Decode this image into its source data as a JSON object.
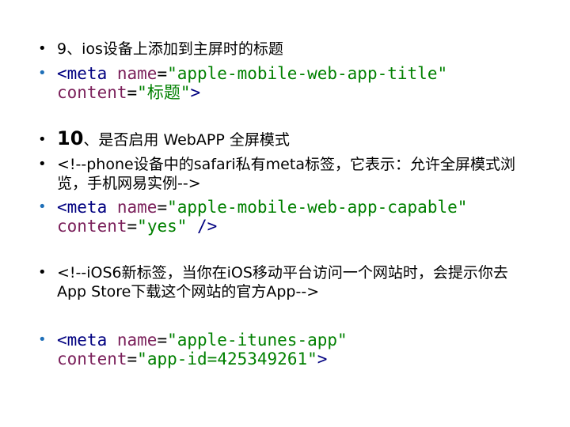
{
  "items": [
    {
      "text": "9、ios设备上添加到主屏时的标题"
    },
    {
      "tag_open": "<meta ",
      "name_attr": "name",
      "eq1": "=",
      "name_val": "\"apple-mobile-web-app-title\"",
      "content_attr": "content",
      "eq2": "=",
      "content_val": "\"标题\"",
      "tag_close": ">"
    },
    {
      "num": "10",
      "text": "、是否启用 WebAPP 全屏模式"
    },
    {
      "text": "<!--phone设备中的safari私有meta标签，它表示：允许全屏模式浏览，手机网易实例-->"
    },
    {
      "tag_open": "<meta ",
      "name_attr": "name",
      "eq1": "=",
      "name_val": "\"apple-mobile-web-app-capable\"",
      "content_attr": "content",
      "eq2": "=",
      "content_val": "\"yes\"",
      "tag_close": " />"
    },
    {
      "text": "<!--iOS6新标签，当你在iOS移动平台访问一个网站时，会提示你去App Store下载这个网站的官方App-->"
    },
    {
      "tag_open": "<meta ",
      "name_attr": "name",
      "eq1": "=",
      "name_val": "\"apple-itunes-app\"",
      "content_attr": "content",
      "eq2": "=",
      "content_val": "\"app-id=425349261\"",
      "tag_close": ">"
    }
  ],
  "bullet_char": "•",
  "colors": {
    "tag": "#000080",
    "attribute": "#7a1f5a",
    "value": "#008000",
    "bullet_blue": "#1e6fb8"
  }
}
